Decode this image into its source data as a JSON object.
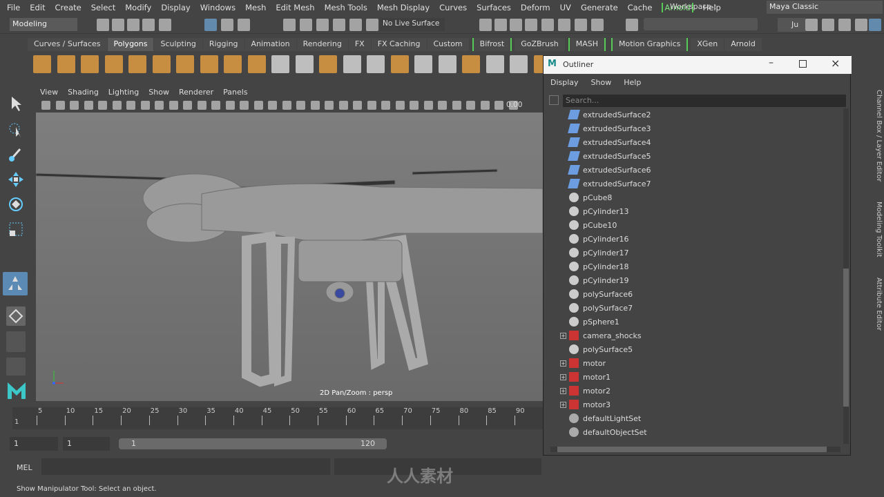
{
  "menu": [
    "File",
    "Edit",
    "Create",
    "Select",
    "Modify",
    "Display",
    "Windows",
    "Mesh",
    "Edit Mesh",
    "Mesh Tools",
    "Mesh Display",
    "Curves",
    "Surfaces",
    "Deform",
    "UV",
    "Generate",
    "Cache",
    "Arnold",
    "Help"
  ],
  "workspace": {
    "label": "Workspace :",
    "value": "Maya Classic"
  },
  "status_line": {
    "mode": "Modeling",
    "live_surface": "No Live Surface",
    "user": "Ju"
  },
  "shelf_tabs": [
    {
      "label": "Curves / Surfaces"
    },
    {
      "label": "Polygons",
      "active": true
    },
    {
      "label": "Sculpting"
    },
    {
      "label": "Rigging"
    },
    {
      "label": "Animation"
    },
    {
      "label": "Rendering"
    },
    {
      "label": "FX"
    },
    {
      "label": "FX Caching"
    },
    {
      "label": "Custom"
    },
    {
      "label": "Bifrost",
      "bracket": true
    },
    {
      "label": "GoZBrush"
    },
    {
      "label": "MASH",
      "bracket": true
    },
    {
      "label": "Motion Graphics",
      "bracket": true
    },
    {
      "label": "XGen"
    },
    {
      "label": "Arnold"
    }
  ],
  "viewport": {
    "menu": [
      "View",
      "Shading",
      "Lighting",
      "Show",
      "Renderer",
      "Panels"
    ],
    "exposure": "0.00",
    "camera_label": "2D Pan/Zoom : persp"
  },
  "outliner": {
    "title": "Outliner",
    "menu": [
      "Display",
      "Show",
      "Help"
    ],
    "search_placeholder": "Search...",
    "items": [
      {
        "name": "extrudedSurface2",
        "type": "surface"
      },
      {
        "name": "extrudedSurface3",
        "type": "surface"
      },
      {
        "name": "extrudedSurface4",
        "type": "surface"
      },
      {
        "name": "extrudedSurface5",
        "type": "surface"
      },
      {
        "name": "extrudedSurface6",
        "type": "surface"
      },
      {
        "name": "extrudedSurface7",
        "type": "surface"
      },
      {
        "name": "pCube8",
        "type": "mesh"
      },
      {
        "name": "pCylinder13",
        "type": "mesh"
      },
      {
        "name": "pCube10",
        "type": "mesh"
      },
      {
        "name": "pCylinder16",
        "type": "mesh"
      },
      {
        "name": "pCylinder17",
        "type": "mesh"
      },
      {
        "name": "pCylinder18",
        "type": "mesh"
      },
      {
        "name": "pCylinder19",
        "type": "mesh"
      },
      {
        "name": "polySurface6",
        "type": "mesh"
      },
      {
        "name": "polySurface7",
        "type": "mesh"
      },
      {
        "name": "pSphere1",
        "type": "mesh"
      },
      {
        "name": "camera_shocks",
        "type": "group",
        "expandable": true
      },
      {
        "name": "polySurface5",
        "type": "mesh"
      },
      {
        "name": "motor",
        "type": "group",
        "expandable": true
      },
      {
        "name": "motor1",
        "type": "group",
        "expandable": true
      },
      {
        "name": "motor2",
        "type": "group",
        "expandable": true
      },
      {
        "name": "motor3",
        "type": "group",
        "expandable": true
      },
      {
        "name": "defaultLightSet",
        "type": "set"
      },
      {
        "name": "defaultObjectSet",
        "type": "set"
      }
    ]
  },
  "timeline": {
    "ticks": [
      "5",
      "10",
      "15",
      "20",
      "25",
      "30",
      "35",
      "40",
      "45",
      "50",
      "55",
      "60",
      "65",
      "70",
      "75",
      "80",
      "85",
      "90"
    ],
    "current": "1"
  },
  "range": {
    "start": "1",
    "current": "1",
    "range_start": "1",
    "range_end": "120"
  },
  "command": {
    "label": "MEL"
  },
  "status_text": "Show Manipulator Tool: Select an object.",
  "right_tabs": [
    "Channel Box / Layer Editor",
    "Modeling Toolkit",
    "Attribute Editor"
  ],
  "watermark": "人人素材"
}
